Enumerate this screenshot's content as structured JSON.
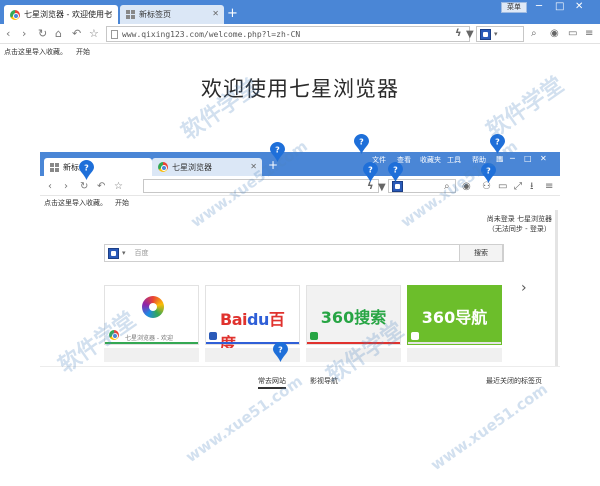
{
  "browser": {
    "tabs": [
      {
        "label": "七星浏览器 - 欢迎使用七",
        "active": true
      },
      {
        "label": "新标签页",
        "active": false
      }
    ],
    "menu_label": "菜单",
    "address": "www.qixing123.com/welcome.php?l=zh-CN",
    "bookmark_bar": [
      "点击这里导入收藏。",
      "开始"
    ]
  },
  "page": {
    "title": "欢迎使用七星浏览器"
  },
  "screenshot": {
    "tabs": [
      {
        "label": "新标签",
        "active": true
      },
      {
        "label": "七星浏览器",
        "active": false
      }
    ],
    "menu_items": [
      "文件",
      "查看",
      "收藏夹",
      "工具",
      "帮助"
    ],
    "bookmark_bar": [
      "点击这里导入收藏。",
      "开始"
    ],
    "login_line1": "尚未登录 七星浏览器",
    "login_line2": "（无法同步 - 登录）",
    "search_placeholder": "百度",
    "search_button": "搜索",
    "tiles": [
      {
        "name": "七星浏览器",
        "caption": "七星浏览器 - 欢迎",
        "bar_color": "#34a853"
      },
      {
        "name": "百度",
        "logo": "Bai",
        "logo_du": "du",
        "logo_cn": "百度",
        "bar_color": "#2f5fd7"
      },
      {
        "name": "360搜索",
        "logo": "360搜索",
        "bar_color": "#e0322e"
      },
      {
        "name": "360导航",
        "logo": "360导航",
        "bar_color": "#e4e4e4"
      }
    ],
    "bottom_tabs": [
      "常去网站",
      "影视导航"
    ],
    "recent_closed": "最近关闭的标签页"
  },
  "watermark": {
    "text": "软件学堂",
    "url": "www.xue51.com"
  },
  "colors": {
    "chrome_blue": "#4a86d6",
    "pin_blue": "#1e6fd9"
  }
}
